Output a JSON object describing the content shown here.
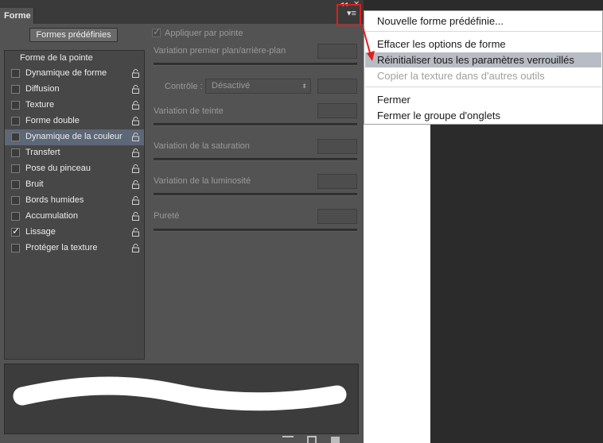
{
  "panel": {
    "tab_title": "Forme",
    "collapse_glyph": "◂◂",
    "close_glyph": "✕",
    "menu_glyph": "▾≡",
    "presets_button": "Formes prédéfinies",
    "apply_per_tip": "Appliquer par pointe",
    "list_header": "Forme de la pointe",
    "items": [
      {
        "label": "Dynamique de forme",
        "checked": false
      },
      {
        "label": "Diffusion",
        "checked": false
      },
      {
        "label": "Texture",
        "checked": false
      },
      {
        "label": "Forme double",
        "checked": false
      },
      {
        "label": "Dynamique de la couleur",
        "checked": false,
        "selected": true
      },
      {
        "label": "Transfert",
        "checked": false
      },
      {
        "label": "Pose du pinceau",
        "checked": false
      },
      {
        "label": "Bruit",
        "checked": false
      },
      {
        "label": "Bords humides",
        "checked": false
      },
      {
        "label": "Accumulation",
        "checked": false
      },
      {
        "label": "Lissage",
        "checked": true
      },
      {
        "label": "Protéger la texture",
        "checked": false
      }
    ],
    "checkmark": "✓",
    "params": {
      "fg_bg": "Variation premier plan/arrière-plan",
      "control_label": "Contrôle :",
      "control_value": "Désactivé",
      "hue": "Variation de teinte",
      "saturation": "Variation de la saturation",
      "brightness": "Variation de la luminosité",
      "purity": "Pureté"
    }
  },
  "menu": {
    "items": [
      {
        "label": "Nouvelle forme prédéfinie...",
        "disabled": false
      },
      {
        "label": "Effacer les options de forme",
        "disabled": false
      },
      {
        "label": "Réinitialiser tous les paramètres verrouillés",
        "disabled": false,
        "highlighted": true
      },
      {
        "label": "Copier la texture dans d'autres outils",
        "disabled": true
      },
      {
        "label": "Fermer",
        "disabled": false
      },
      {
        "label": "Fermer le groupe d'onglets",
        "disabled": false
      }
    ]
  },
  "colors": {
    "panel_bg": "#535353",
    "selected_row": "#5c6777",
    "menu_highlight": "#b8bcc4",
    "annotation_red": "#e31c1c"
  }
}
